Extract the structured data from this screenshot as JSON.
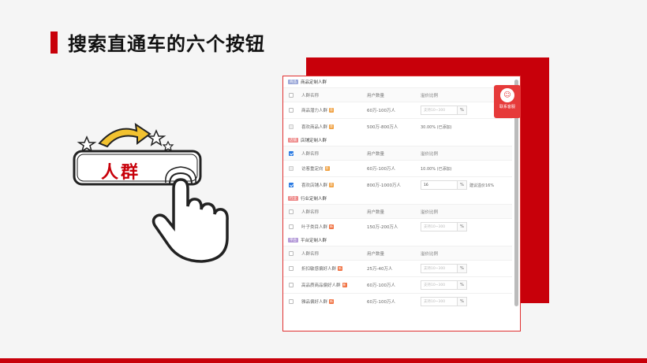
{
  "slide": {
    "title": "搜索直通车的六个按钮"
  },
  "illustration": {
    "label": "人群"
  },
  "contact": {
    "label": "联系客服"
  },
  "sections": [
    {
      "tag": "商品",
      "title": "商品定制人群",
      "headers": [
        "人群名称",
        "用户数量",
        "溢价比例"
      ],
      "rows": [
        {
          "name": "商品潜力人群",
          "badge": "荐",
          "count": "60万-100万人",
          "ratio_placeholder": "支持10~300",
          "checkbox": "empty"
        },
        {
          "name": "喜欢商品人群",
          "badge": "荐",
          "count": "500万-800万人",
          "ratio_text": "30.00% (已添加)",
          "checkbox": "disabled"
        }
      ]
    },
    {
      "tag": "店铺",
      "title": "店铺定制人群",
      "headers": [
        "人群名称",
        "用户数量",
        "溢价比例"
      ],
      "rows": [
        {
          "name": "访客重定向",
          "badge": "荐",
          "count": "60万-100万人",
          "ratio_text": "10.00% (已添加)",
          "checkbox": "disabled"
        },
        {
          "name": "喜欢店铺人群",
          "badge": "荐",
          "count": "800万-1000万人",
          "ratio_value": "16",
          "suggest": "建议溢价16%",
          "checkbox": "checked"
        }
      ]
    },
    {
      "tag": "行业",
      "title": "行业定制人群",
      "headers": [
        "人群名称",
        "用户数量",
        "溢价比例"
      ],
      "rows": [
        {
          "name": "叶子类目人群",
          "badge": "新",
          "count": "150万-200万人",
          "ratio_placeholder": "支持10~300",
          "checkbox": "empty"
        }
      ]
    },
    {
      "tag": "平台",
      "title": "平台定制人群",
      "headers": [
        "人群名称",
        "用户数量",
        "溢价比例"
      ],
      "rows": [
        {
          "name": "折扣敏感偏好人群",
          "badge": "新",
          "count": "25万-40万人",
          "ratio_placeholder": "支持10~300",
          "checkbox": "empty"
        },
        {
          "name": "高品质商品偏好人群",
          "badge": "新",
          "count": "60万-100万人",
          "ratio_placeholder": "支持10~300",
          "checkbox": "empty"
        },
        {
          "name": "雅品偏好人群",
          "badge": "新",
          "count": "60万-100万人",
          "ratio_placeholder": "支持10~300",
          "checkbox": "empty"
        }
      ]
    }
  ],
  "pct_symbol": "%",
  "colors": {
    "accent": "#c8000a",
    "checkbox_blue": "#2a7ae2",
    "contact_red": "#e63a3a"
  },
  "icons": [
    "pointing-hand-icon",
    "arrow-icon",
    "star-icon",
    "checkbox-icon",
    "customer-service-icon"
  ]
}
